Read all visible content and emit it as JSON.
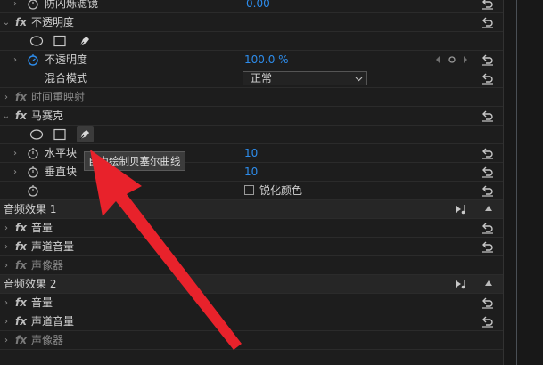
{
  "rows": {
    "flicker_label": "防闪烁滤镜",
    "flicker_value": "0.00",
    "opacity_section": "不透明度",
    "opacity_label": "不透明度",
    "opacity_value": "100.0 %",
    "blend_label": "混合模式",
    "blend_value": "正常",
    "time_remap": "时间重映射",
    "mosaic_section": "马赛克",
    "hblock_label": "水平块",
    "hblock_value": "10",
    "vblock_label": "垂直块",
    "vblock_value": "10",
    "sharpen_label": "锐化颜色"
  },
  "audio1": {
    "header": "音频效果 1",
    "volume": "音量",
    "channel_volume": "声道音量",
    "panner": "声像器"
  },
  "audio2": {
    "header": "音频效果 2",
    "volume": "音量",
    "channel_volume": "声道音量",
    "panner": "声像器"
  },
  "tooltip": "自由绘制贝塞尔曲线",
  "fx_label": "fx",
  "colors": {
    "value_blue": "#2d8ceb",
    "arrow_red": "#e8222b",
    "panel_bg": "#1d1d1d"
  },
  "icons": [
    "chevron-right-icon",
    "chevron-down-icon",
    "stopwatch-icon",
    "ellipse-mask-icon",
    "rectangle-mask-icon",
    "pen-mask-icon",
    "reset-icon",
    "keyframe-prev-icon",
    "keyframe-add-icon",
    "keyframe-next-icon",
    "audio-play-icon",
    "collapse-up-icon"
  ]
}
